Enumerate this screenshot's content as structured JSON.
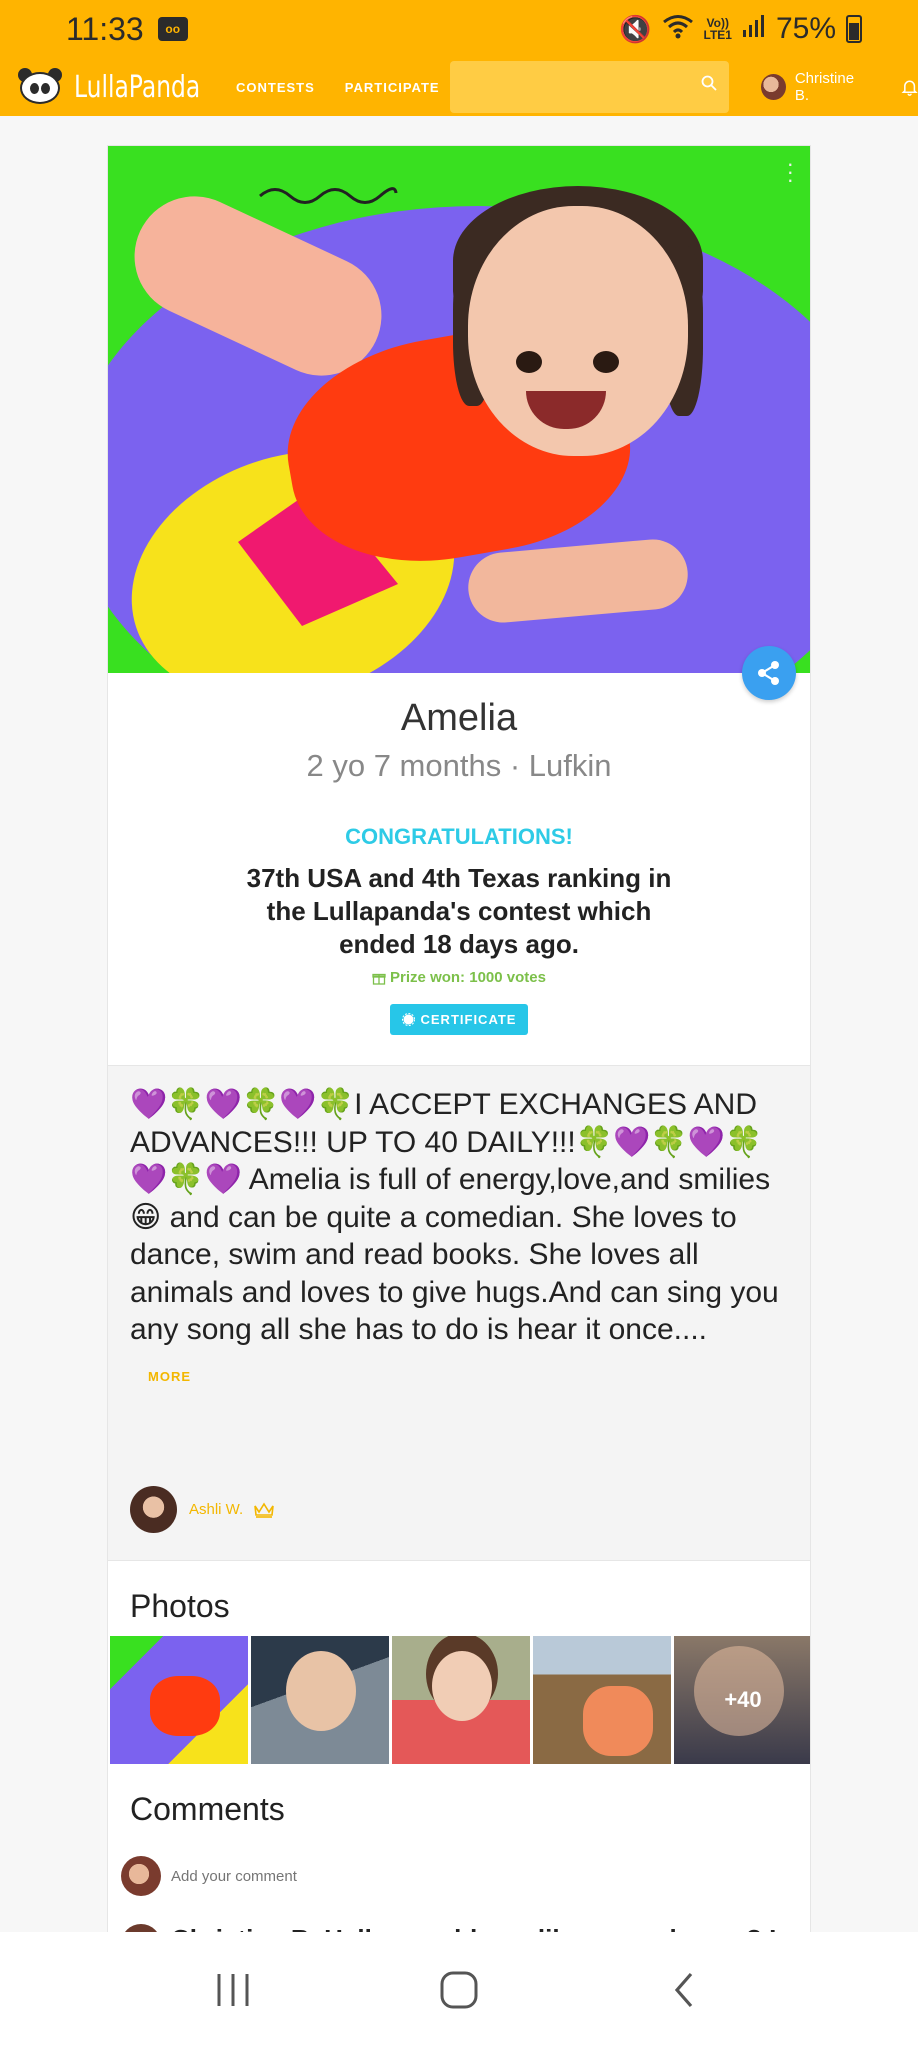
{
  "status_bar": {
    "time": "11:33",
    "voicemail_icon": "voicemail-icon",
    "lte_label_top": "Vo))",
    "lte_label_bottom": "LTE1",
    "battery": "75%"
  },
  "nav": {
    "logo_text": "LullaPanda",
    "contests_label": "CONTESTS",
    "participate_label": "PARTICIPATE",
    "search_placeholder": "",
    "user_name": "Christine B."
  },
  "profile": {
    "name": "Amelia",
    "meta": "2 yo 7 months · Lufkin",
    "congrats": "CONGRATULATIONS!",
    "ranking": "37th USA and 4th Texas ranking in the Lullapanda's contest which ended 18 days ago.",
    "prize": "Prize won: 1000 votes",
    "certificate_label": "CERTIFICATE"
  },
  "description": {
    "text": "💜🍀💜🍀💜🍀I ACCEPT EXCHANGES AND ADVANCES!!! UP TO 40 DAILY!!!🍀💜🍀💜🍀💜🍀💜 Amelia is full of energy,love,and smilies😁 and can be quite a comedian. She loves to dance, swim and read books. She loves all animals and loves to give hugs.And can sing you any song all she has to do is hear it once....",
    "more_label": "MORE",
    "owner_name": "Ashli W."
  },
  "photos": {
    "title": "Photos",
    "more_count": "+40"
  },
  "comments": {
    "title": "Comments",
    "placeholder": "Add your comment",
    "peek_text": "Christine B. Hello, would you like an exchange? I"
  },
  "colors": {
    "brand": "#ffb400",
    "accent_cyan": "#27c6e8",
    "share_blue": "#3aa0f0",
    "gold_text": "#f3b700",
    "prize_green": "#7cc04a"
  }
}
